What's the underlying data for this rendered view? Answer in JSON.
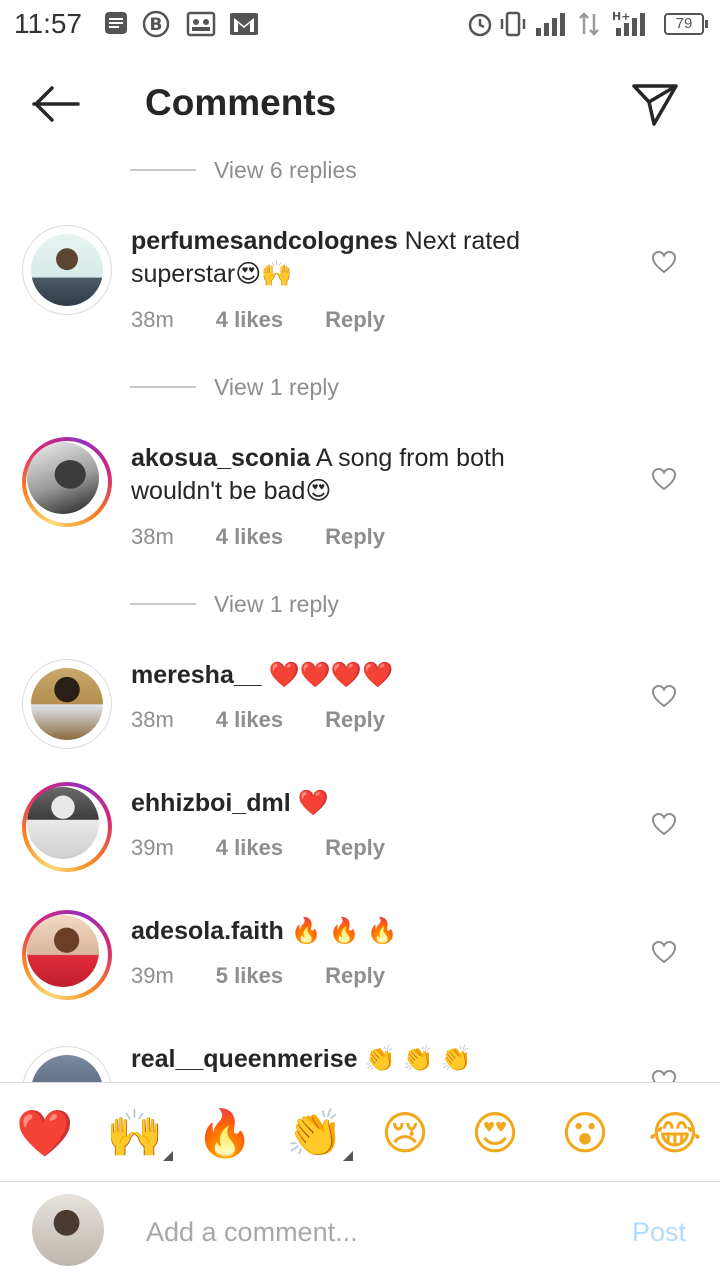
{
  "status_bar": {
    "time": "11:57",
    "battery": "79",
    "network": "H+"
  },
  "header": {
    "title": "Comments",
    "back_icon": "arrow-left-icon",
    "send_icon": "paper-plane-icon"
  },
  "view_replies": [
    "View 6 replies",
    "View 1 reply",
    "View 1 reply"
  ],
  "comments": [
    {
      "username": "perfumesandcolognes",
      "text": " Next rated superstar😍🙌",
      "time": "38m",
      "likes": "4 likes",
      "reply": "Reply",
      "story_ring": false
    },
    {
      "username": "akosua_sconia",
      "text": " A song from both wouldn't be bad😍",
      "time": "38m",
      "likes": "4 likes",
      "reply": "Reply",
      "story_ring": true
    },
    {
      "username": "meresha__",
      "text": " ❤️❤️❤️❤️",
      "time": "38m",
      "likes": "4 likes",
      "reply": "Reply",
      "story_ring": false
    },
    {
      "username": "ehhizboi_dml",
      "text": " ❤️",
      "time": "39m",
      "likes": "4 likes",
      "reply": "Reply",
      "story_ring": true
    },
    {
      "username": "adesola.faith",
      "text": " 🔥 🔥 🔥",
      "time": "39m",
      "likes": "5 likes",
      "reply": "Reply",
      "story_ring": true
    },
    {
      "username": "real__queenmerise",
      "text": " 👏 👏 👏",
      "story_ring": false
    }
  ],
  "emoji_bar": [
    "❤️",
    "🙌",
    "🔥",
    "👏",
    "😢",
    "😍",
    "😮",
    "😂"
  ],
  "composer": {
    "placeholder": "Add a comment...",
    "post_label": "Post"
  },
  "colors": {
    "text": "#262626",
    "muted": "#8e8e8e",
    "post_disabled": "#b3dbff",
    "heart": "#ed4956"
  }
}
